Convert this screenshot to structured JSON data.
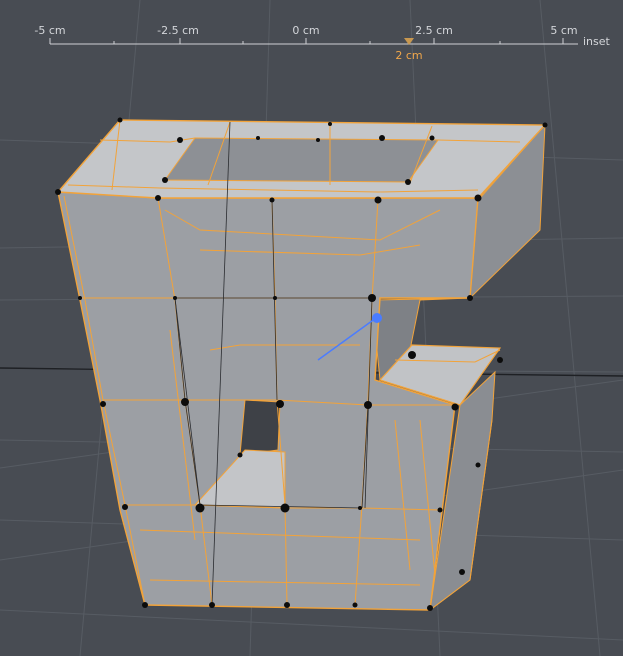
{
  "ruler": {
    "ticks": [
      "-5 cm",
      "-2.5 cm",
      "0 cm",
      "2.5 cm",
      "5 cm"
    ],
    "tool_label": "inset",
    "value": "2 cm"
  },
  "colors": {
    "background": "#484c53",
    "grid": "#5b6068",
    "mesh_fill": "#9b9ea3",
    "mesh_top": "#c7c9cc",
    "selection_edge": "#f2a33a",
    "wire": "#2a2c30",
    "vertex": "#0c0c0c",
    "handle": "#4a7cff"
  },
  "icons": {
    "slider_marker": "triangle-down-icon",
    "transform_handle": "move-handle-icon"
  }
}
